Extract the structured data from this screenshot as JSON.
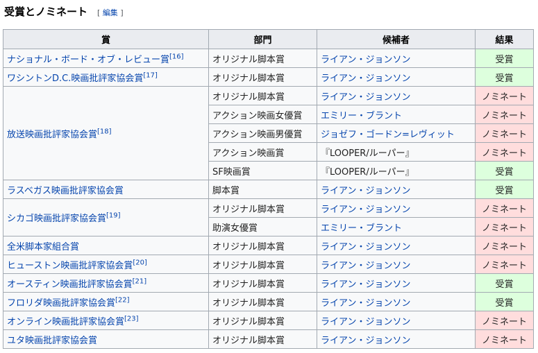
{
  "section": {
    "title": "受賞とノミネート",
    "edit_open": "[",
    "edit_label": "編集",
    "edit_close": "]"
  },
  "table": {
    "headers": [
      "賞",
      "部門",
      "候補者",
      "結果"
    ],
    "rows": [
      {
        "award": "ナショナル・ボード・オブ・レビュー賞",
        "ref": "[16]",
        "category": "オリジナル脚本賞",
        "nominee": "ライアン・ジョンソン",
        "result": "受賞"
      },
      {
        "award": "ワシントンD.C.映画批評家協会賞",
        "ref": "[17]",
        "category": "オリジナル脚本賞",
        "nominee": "ライアン・ジョンソン",
        "result": "受賞"
      },
      {
        "award": "放送映画批評家協会賞",
        "ref": "[18]",
        "category": "オリジナル脚本賞",
        "nominee": "ライアン・ジョンソン",
        "result": "ノミネート"
      },
      {
        "category": "アクション映画女優賞",
        "nominee": "エミリー・ブラント",
        "result": "ノミネート"
      },
      {
        "category": "アクション映画男優賞",
        "nominee": "ジョゼフ・ゴードン=レヴィット",
        "result": "ノミネート"
      },
      {
        "category": "アクション映画賞",
        "nominee": "『LOOPER/ルーパー』",
        "result": "ノミネート"
      },
      {
        "category": "SF映画賞",
        "nominee": "『LOOPER/ルーパー』",
        "result": "受賞"
      },
      {
        "award": "ラスベガス映画批評家協会賞",
        "category": "脚本賞",
        "nominee": "ライアン・ジョンソン",
        "result": "受賞"
      },
      {
        "award": "シカゴ映画批評家協会賞",
        "ref": "[19]",
        "category": "オリジナル脚本賞",
        "nominee": "ライアン・ジョンソン",
        "result": "ノミネート"
      },
      {
        "category": "助演女優賞",
        "nominee": "エミリー・ブラント",
        "result": "ノミネート"
      },
      {
        "award": "全米脚本家組合賞",
        "category": "オリジナル脚本賞",
        "nominee": "ライアン・ジョンソン",
        "result": "ノミネート"
      },
      {
        "award": "ヒューストン映画批評家協会賞",
        "ref": "[20]",
        "category": "オリジナル脚本賞",
        "nominee": "ライアン・ジョンソン",
        "result": "ノミネート"
      },
      {
        "award": "オースティン映画批評家協会賞",
        "ref": "[21]",
        "category": "オリジナル脚本賞",
        "nominee": "ライアン・ジョンソン",
        "result": "受賞"
      },
      {
        "award": "フロリダ映画批評家協会賞",
        "ref": "[22]",
        "category": "オリジナル脚本賞",
        "nominee": "ライアン・ジョンソン",
        "result": "受賞"
      },
      {
        "award": "オンライン映画批評家協会賞",
        "ref": "[23]",
        "category": "オリジナル脚本賞",
        "nominee": "ライアン・ジョンソン",
        "result": "ノミネート"
      },
      {
        "award": "ユタ映画批評家協会賞",
        "category": "オリジナル脚本賞",
        "nominee": "ライアン・ジョンソン",
        "result": "ノミネート"
      }
    ]
  }
}
